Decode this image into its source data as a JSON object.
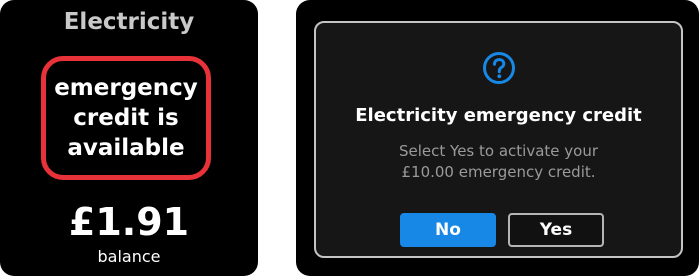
{
  "left_screen": {
    "title": "Electricity",
    "alert": {
      "line1": "emergency",
      "line2": "credit is",
      "line3": "available",
      "border_color": "#e63238"
    },
    "balance": {
      "amount": "£1.91",
      "label": "balance"
    }
  },
  "right_screen": {
    "icon": "question-icon",
    "accent_color": "#1788e6",
    "dialog_title": "Electricity emergency credit",
    "message_line1": "Select Yes to activate your",
    "message_line2": "£10.00 emergency credit.",
    "buttons": {
      "no_label": "No",
      "yes_label": "Yes"
    }
  }
}
